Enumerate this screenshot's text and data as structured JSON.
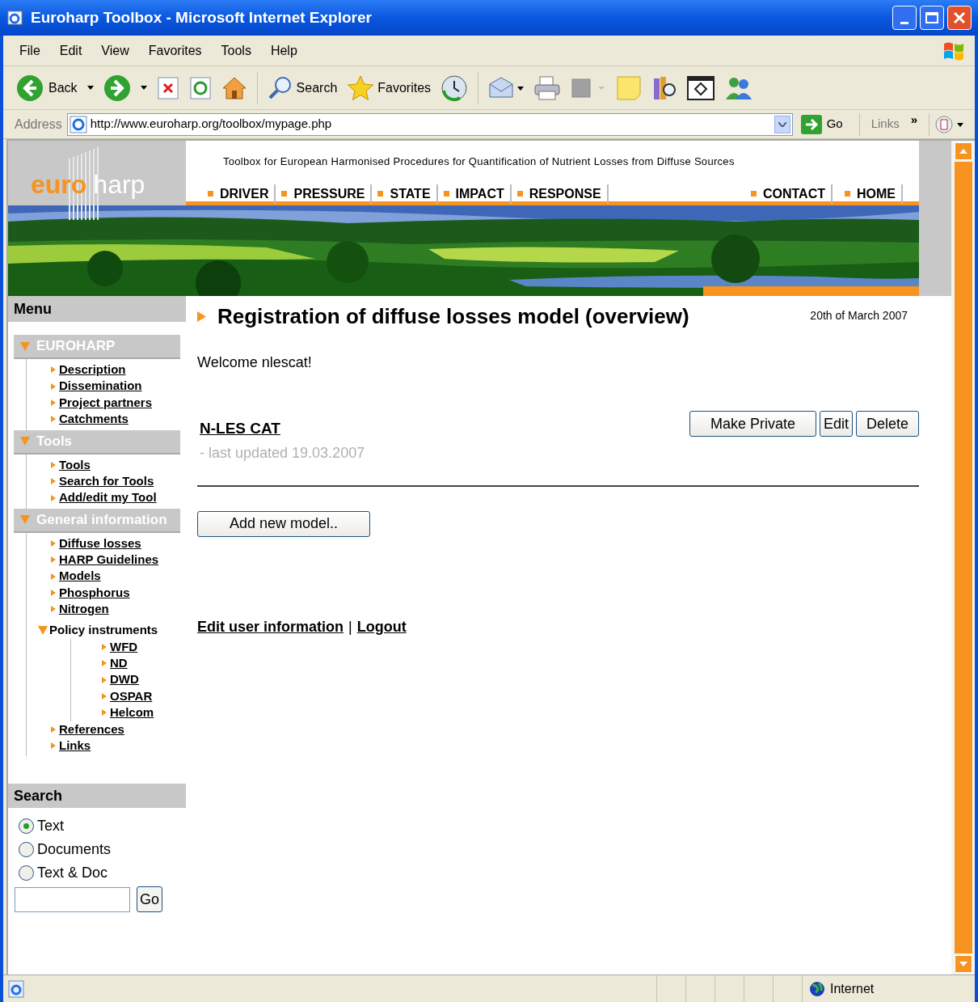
{
  "window": {
    "title": "Euroharp Toolbox - Microsoft Internet Explorer"
  },
  "menu_bar": [
    "File",
    "Edit",
    "View",
    "Favorites",
    "Tools",
    "Help"
  ],
  "toolbar": {
    "back": "Back",
    "search": "Search",
    "favorites": "Favorites"
  },
  "address_bar": {
    "label": "Address",
    "value": "http://www.euroharp.org/toolbox/mypage.php",
    "go": "Go",
    "links": "Links",
    "more": "»"
  },
  "header": {
    "logo_left": "euro",
    "logo_right": "harp",
    "tagline": "Toolbox for European Harmonised Procedures for Quantification of Nutrient Losses from Diffuse Sources",
    "nav_left": [
      "DRIVER",
      "PRESSURE",
      "STATE",
      "IMPACT",
      "RESPONSE"
    ],
    "nav_right": [
      "CONTACT",
      "HOME"
    ]
  },
  "sidebar": {
    "title": "Menu",
    "sections": [
      {
        "title": "EUROHARP",
        "items": [
          {
            "label": "Description"
          },
          {
            "label": "Dissemination"
          },
          {
            "label": "Project partners"
          },
          {
            "label": "Catchments"
          }
        ]
      },
      {
        "title": "Tools",
        "items": [
          {
            "label": "Tools"
          },
          {
            "label": "Search for Tools"
          },
          {
            "label": "Add/edit my Tool"
          }
        ]
      },
      {
        "title": "General information",
        "items": [
          {
            "label": "Diffuse losses"
          },
          {
            "label": "HARP Guidelines"
          },
          {
            "label": "Models"
          },
          {
            "label": "Phosphorus"
          },
          {
            "label": "Nitrogen"
          },
          {
            "label": "Policy instruments",
            "children": [
              {
                "label": "WFD"
              },
              {
                "label": "ND"
              },
              {
                "label": "DWD"
              },
              {
                "label": "OSPAR"
              },
              {
                "label": "Helcom"
              }
            ]
          },
          {
            "label": "References"
          },
          {
            "label": "Links"
          }
        ]
      }
    ]
  },
  "search": {
    "title": "Search",
    "options": [
      {
        "label": "Text",
        "selected": true
      },
      {
        "label": "Documents",
        "selected": false
      },
      {
        "label": "Text & Doc",
        "selected": false
      }
    ],
    "button": "Go"
  },
  "main": {
    "heading": "Registration of diffuse losses model (overview)",
    "date": "20th of March 2007",
    "welcome": "Welcome nlescat!",
    "models": [
      {
        "name": "N-LES CAT",
        "updated": "- last updated 19.03.2007",
        "actions": [
          "Make Private",
          "Edit",
          "Delete"
        ]
      }
    ],
    "add_button": "Add new model..",
    "user_links": [
      "Edit user information",
      "Logout"
    ],
    "separator": "|"
  },
  "status_bar": {
    "zone": "Internet"
  }
}
